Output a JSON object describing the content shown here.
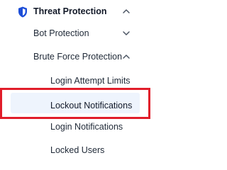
{
  "menu": {
    "threat_protection": {
      "label": "Threat Protection",
      "icon": "shield-icon",
      "state": "expanded"
    },
    "bot_protection": {
      "label": "Bot Protection",
      "icon": "chevron-down-icon",
      "state": "collapsed"
    },
    "brute_force_protection": {
      "label": "Brute Force Protection",
      "icon": "chevron-up-icon",
      "state": "expanded"
    },
    "items": [
      {
        "label": "Login Attempt Limits"
      },
      {
        "label": "Lockout Notifications",
        "active": true
      },
      {
        "label": "Login Notifications"
      },
      {
        "label": "Locked Users"
      }
    ]
  },
  "colors": {
    "accent": "#1d4ed8",
    "highlight_border": "#e11d2a",
    "active_bg": "#eef4fd",
    "text": "#1f2937"
  }
}
